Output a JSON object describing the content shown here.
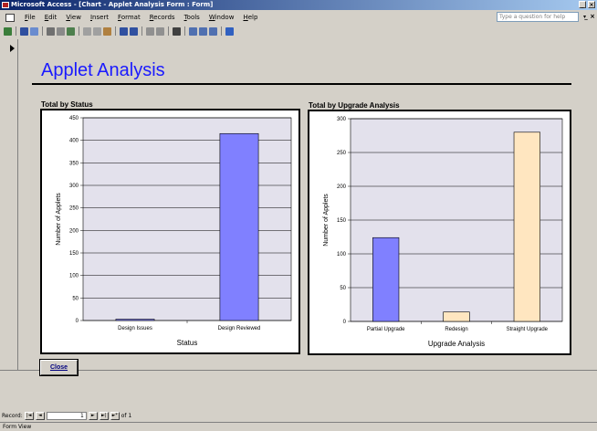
{
  "window": {
    "title": "Microsoft Access - [Chart - Applet Analysis Form : Form]",
    "min_label": "_",
    "close_label": "×"
  },
  "menubar": {
    "items": [
      "File",
      "Edit",
      "View",
      "Insert",
      "Format",
      "Records",
      "Tools",
      "Window",
      "Help"
    ],
    "help_placeholder": "Type a question for help",
    "right_glyph": "_ ×"
  },
  "form": {
    "title": "Applet Analysis",
    "close_label": "Close"
  },
  "charts": {
    "status": {
      "label": "Total by Status"
    },
    "upgrade": {
      "label": "Total by Upgrade Analysis"
    }
  },
  "chart_data": [
    {
      "type": "bar",
      "title": "Total by Status",
      "categories": [
        "Design Issues",
        "Design Reviewed"
      ],
      "values": [
        3,
        415
      ],
      "colors": [
        "#8080ff",
        "#8080ff"
      ],
      "xlabel": "Status",
      "ylabel": "Number of Applets",
      "ylim": [
        0,
        450
      ],
      "yticks": [
        0,
        50,
        100,
        150,
        200,
        250,
        300,
        350,
        400,
        450
      ],
      "grid": true
    },
    {
      "type": "bar",
      "title": "Total by Upgrade Analysis",
      "categories": [
        "Partial Upgrade",
        "Redesign",
        "Straight Upgrade"
      ],
      "values": [
        124,
        14,
        280
      ],
      "colors": [
        "#8080ff",
        "#ffe6c0",
        "#ffe6c0"
      ],
      "xlabel": "Upgrade Analysis",
      "ylabel": "Number of Applets",
      "ylim": [
        0,
        300
      ],
      "yticks": [
        0,
        50,
        100,
        150,
        200,
        250,
        300
      ],
      "grid": true
    }
  ],
  "recnav": {
    "label": "Record:",
    "first": "|◄",
    "prev": "◄",
    "current": "1",
    "next": "►",
    "last": "►|",
    "new": "►*",
    "of_label": "of 1"
  },
  "status": {
    "text": "Form View"
  }
}
